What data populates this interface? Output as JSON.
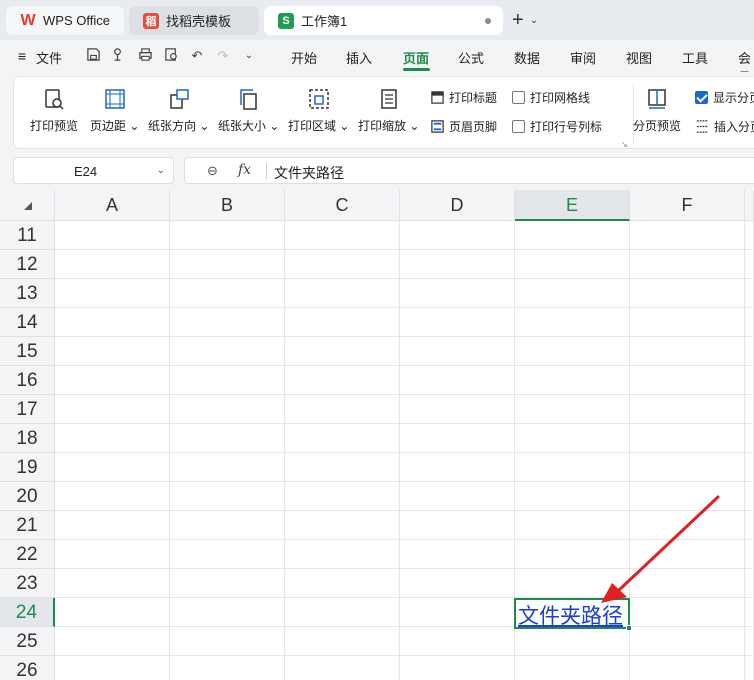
{
  "tabs": [
    {
      "label": "WPS Office"
    },
    {
      "label": "找稻壳模板"
    },
    {
      "label": "工作簿1"
    }
  ],
  "menubar": {
    "file_label": "文件",
    "items": [
      "开始",
      "插入",
      "页面",
      "公式",
      "数据",
      "审阅",
      "视图",
      "工具",
      "会员"
    ],
    "active": "页面"
  },
  "ribbon": {
    "print_preview": "打印预览",
    "margins": "页边距",
    "orientation": "纸张方向",
    "paper_size": "纸张大小",
    "print_area": "打印区域",
    "print_scale": "打印缩放",
    "print_titles": "打印标题",
    "header_footer": "页眉页脚",
    "print_gridlines": "打印网格线",
    "print_row_col_headers": "打印行号列标",
    "page_break_preview": "分页预览",
    "show_page_breaks": "显示分页",
    "insert_page_break": "插入分页",
    "show_page_breaks_checked": true
  },
  "formula_bar": {
    "name_box": "E24",
    "fx": "fx",
    "formula": "文件夹路径"
  },
  "grid": {
    "columns": [
      "A",
      "B",
      "C",
      "D",
      "E",
      "F"
    ],
    "rows": [
      "11",
      "12",
      "13",
      "14",
      "15",
      "16",
      "17",
      "18",
      "19",
      "20",
      "21",
      "22",
      "23",
      "24",
      "25",
      "26"
    ],
    "selected_column": "E",
    "selected_row": "24",
    "cell_E24": "文件夹路径"
  },
  "colors": {
    "accent": "#1f8a4c",
    "link": "#1a3ed6",
    "arrow": "#e02020"
  }
}
